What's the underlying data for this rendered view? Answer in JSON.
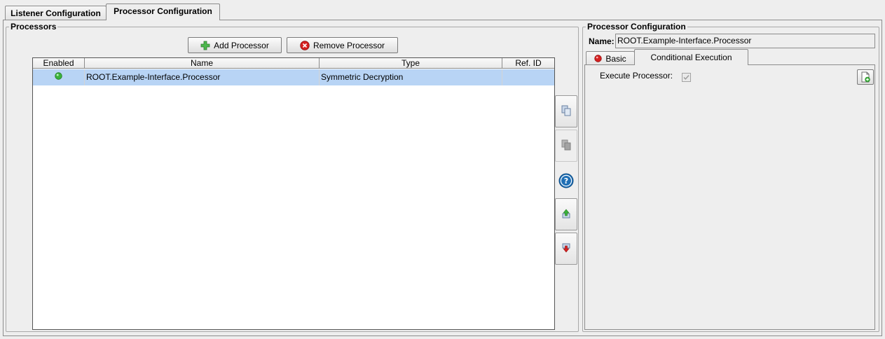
{
  "tabs": [
    {
      "label": "Listener Configuration",
      "active": false
    },
    {
      "label": "Processor Configuration",
      "active": true
    }
  ],
  "processors": {
    "title": "Processors",
    "add_label": "Add Processor",
    "remove_label": "Remove Processor",
    "columns": [
      "Enabled",
      "Name",
      "Type",
      "Ref. ID"
    ],
    "rows": [
      {
        "enabled": true,
        "name": "ROOT.Example-Interface.Processor",
        "type": "Symmetric Decryption",
        "ref_id": ""
      }
    ]
  },
  "side_toolbar": [
    "copy-icon",
    "paste-icon",
    "help-icon",
    "move-up-icon",
    "move-down-icon"
  ],
  "config": {
    "title": "Processor Configuration",
    "name_label": "Name:",
    "name_value": "ROOT.Example-Interface.Processor",
    "subtabs": [
      {
        "label": "Basic",
        "active": false,
        "icon": "error-icon"
      },
      {
        "label": "Conditional Execution",
        "active": true
      }
    ],
    "execute_label": "Execute Processor:",
    "execute_checked": true
  },
  "colors": {
    "selection": "#b8d4f5",
    "enabled": "#3bb33b",
    "error": "#d62020",
    "help": "#1f6fb5"
  }
}
